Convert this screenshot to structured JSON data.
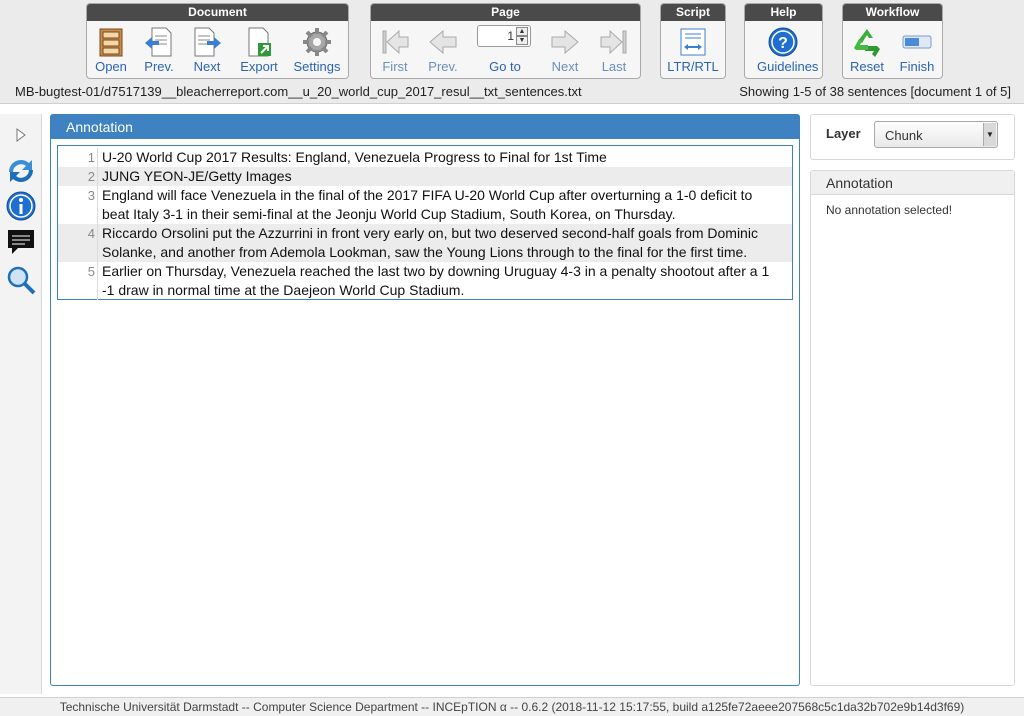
{
  "toolbar": {
    "document": {
      "title": "Document",
      "buttons": [
        {
          "label": "Open",
          "icon": "cabinet-icon"
        },
        {
          "label": "Prev.",
          "icon": "prev-document-icon"
        },
        {
          "label": "Next",
          "icon": "next-document-icon"
        },
        {
          "label": "Export",
          "icon": "export-icon"
        },
        {
          "label": "Settings",
          "icon": "gear-icon"
        }
      ]
    },
    "page": {
      "title": "Page",
      "page_number": "1",
      "buttons": [
        {
          "label": "First",
          "icon": "first-page-icon"
        },
        {
          "label": "Prev.",
          "icon": "prev-page-icon"
        },
        {
          "label": "Go to",
          "icon": "page-number-input"
        },
        {
          "label": "Next",
          "icon": "next-page-icon"
        },
        {
          "label": "Last",
          "icon": "last-page-icon"
        }
      ]
    },
    "script": {
      "title": "Script",
      "buttons": [
        {
          "label": "LTR/RTL",
          "icon": "text-direction-icon"
        }
      ]
    },
    "help": {
      "title": "Help",
      "buttons": [
        {
          "label": "Guidelines",
          "icon": "help-icon"
        }
      ]
    },
    "workflow": {
      "title": "Workflow",
      "buttons": [
        {
          "label": "Reset",
          "icon": "recycle-icon"
        },
        {
          "label": "Finish",
          "icon": "finish-icon"
        }
      ]
    }
  },
  "info": {
    "document_path": "MB-bugtest-01/d7517139__bleacherreport.com__u_20_world_cup_2017_resul__txt_sentences.txt",
    "showing": "Showing 1-5 of 38 sentences [document 1 of 5]"
  },
  "sidebar": {
    "icons": [
      "expand-icon",
      "sync-icon",
      "info-icon",
      "comment-icon",
      "search-icon"
    ]
  },
  "annotation_panel": {
    "title": "Annotation",
    "sentences": [
      {
        "num": "1",
        "lines": [
          "U-20 World Cup 2017 Results: England, Venezuela Progress to Final for 1st Time"
        ]
      },
      {
        "num": "2",
        "lines": [
          "JUNG YEON-JE/Getty Images"
        ]
      },
      {
        "num": "3",
        "lines": [
          "England will face Venezuela in the final of the 2017 FIFA U-20 World Cup after overturning a 1-0 deficit to",
          "beat Italy 3-1 in their semi-final at the Jeonju World Cup Stadium, South Korea, on Thursday."
        ]
      },
      {
        "num": "4",
        "lines": [
          "Riccardo Orsolini put the Azzurrini in front very early on, but two deserved second-half goals from Dominic",
          "Solanke, and another from Ademola Lookman, saw the Young Lions through to the final for the first time."
        ]
      },
      {
        "num": "5",
        "lines": [
          "Earlier on Thursday, Venezuela reached the last two by downing Uruguay 4-3 in a penalty shootout after a 1",
          "-1 draw in normal time at the Daejeon World Cup Stadium."
        ]
      }
    ]
  },
  "layer": {
    "label": "Layer",
    "selected": "Chunk"
  },
  "detail_panel": {
    "title": "Annotation",
    "message": "No annotation selected!"
  },
  "footer": {
    "text": "Technische Universität Darmstadt -- Computer Science Department -- INCEpTION α -- 0.6.2 (2018-11-12 15:17:55, build a125fe72aeee207568c5c1da32b702e9b14d3f69)"
  },
  "colors": {
    "accent": "#3e82c2",
    "link": "#2a64b3",
    "toolbar_header": "#4a4a4a"
  }
}
